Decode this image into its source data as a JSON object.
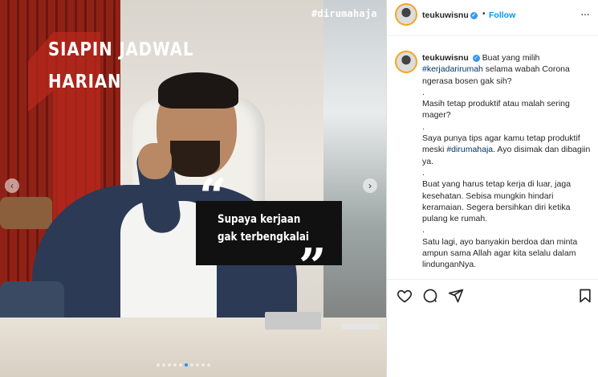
{
  "media": {
    "hashtag": "#dirumahaja",
    "headline_line1": "SIAPIN JADWAL",
    "headline_line2": "HARIAN",
    "quote_line1": "Supaya kerjaan",
    "quote_line2": "gak terbengkalai",
    "quote_open": "“",
    "quote_close": "”",
    "prev_arrow": "‹",
    "next_arrow": "›",
    "dots_count": 10,
    "active_dot": 5
  },
  "header": {
    "username": "teukuwisnu",
    "verified_mark": "✓",
    "separator": "•",
    "follow_label": "Follow",
    "more_label": "···"
  },
  "caption": {
    "username": "teukuwisnu",
    "lines": [
      {
        "type": "first",
        "pre": "Buat yang milih",
        "tag": "#kerjadarirumah",
        "post": "selama wabah Corona ngerasa bosen gak sih?"
      },
      {
        "type": "text",
        "text": "."
      },
      {
        "type": "text",
        "text": "Masih tetap produktif atau malah sering mager?"
      },
      {
        "type": "text",
        "text": "."
      },
      {
        "type": "mixed",
        "pre": "Saya punya tips agar kamu tetap produktif meski",
        "tag": "#dirumahaja",
        "post": ". Ayo disimak dan dibagiin ya."
      },
      {
        "type": "text",
        "text": "."
      },
      {
        "type": "text",
        "text": "Buat yang harus tetap kerja di luar, jaga kesehatan. Sebisa mungkin hindari keramaian. Segera bersihkan diri ketika pulang ke rumah."
      },
      {
        "type": "text",
        "text": "."
      },
      {
        "type": "text",
        "text": "Satu lagi, ayo banyakin berdoa dan minta ampun sama Allah agar kita selalu dalam lindunganNya."
      }
    ]
  },
  "actions": [
    "heart-icon",
    "comment-icon",
    "share-icon",
    "bookmark-icon"
  ],
  "colors": {
    "accent": "#0095f6",
    "hashtag": "#00376b",
    "text": "#262626"
  }
}
